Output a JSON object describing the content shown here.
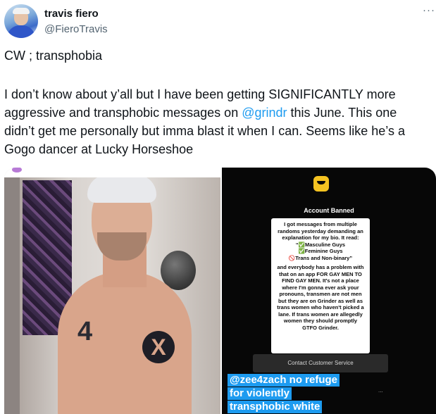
{
  "tweet": {
    "author": {
      "display_name": "travis fiero",
      "handle": "@FieroTravis"
    },
    "more_menu_label": "···",
    "lines": [
      "CW ; transphobia",
      "I don’t know about y’all but I have been getting SIGNIFICANTLY more",
      "aggressive and transphobic messages on",
      "@grindr",
      " this June.  This one",
      "didn’t get me personally but imma blast it when I can.   Seems like he’s a",
      "Gogo dancer at Lucky Horseshoe"
    ],
    "media": {
      "left_image": {
        "tattoo_left": "4",
        "tattoo_right": "X"
      },
      "right_image": {
        "title": "Account Banned",
        "story_lines": [
          "I got messages from multiple",
          "randoms yesterday demanding an",
          "explanation for my bio. It read:",
          "“✅Masculine Guys",
          "✅Feminine Guys",
          "🚫Trans and Non-binary”",
          "and everybody has a problem with",
          "that on an app FOR GAY MEN TO",
          "FIND GAY MEN. It's not a place",
          "where I'm gonna ever ask your",
          "pronouns, transmen are not men",
          "but they are on Grinder as well as",
          "trans women who haven't picked a",
          "lane. If trans women are allegedly",
          "women they should promptly",
          "GTFO Grinder."
        ],
        "support_button": "Contact Customer Service",
        "overlay_lines": [
          "@zee4zach no refuge",
          "for violently",
          "transphobic white"
        ],
        "reply_dots": "..."
      }
    }
  }
}
